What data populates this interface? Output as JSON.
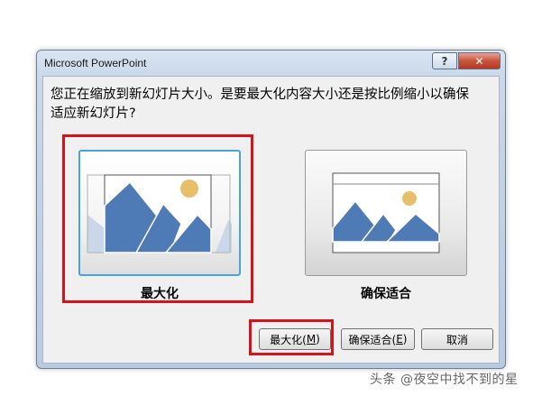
{
  "window": {
    "title": "Microsoft PowerPoint",
    "help_label": "?",
    "close_label": "✕"
  },
  "dialog": {
    "question_line1": "您正在缩放到新幻灯片大小。是要最大化内容大小还是按比例缩小以确保",
    "question_line2": "适应新幻灯片?"
  },
  "options": [
    {
      "label": "最大化",
      "icon": "maximize-preview-icon"
    },
    {
      "label": "确保适合",
      "icon": "ensure-fit-preview-icon"
    }
  ],
  "buttons": {
    "maximize_label": "最大化(",
    "maximize_key": "M",
    "maximize_tail": ")",
    "ensure_fit_label": "确保适合(",
    "ensure_fit_key": "E",
    "ensure_fit_tail": ")",
    "cancel_label": "取消"
  },
  "watermark": "头条 @夜空中找不到的星",
  "colors": {
    "highlight_red": "#d6121b",
    "selected_border": "#4aa3d6",
    "mountain_blue": "#4e7ab5",
    "sun_gold": "#e7be6a"
  }
}
